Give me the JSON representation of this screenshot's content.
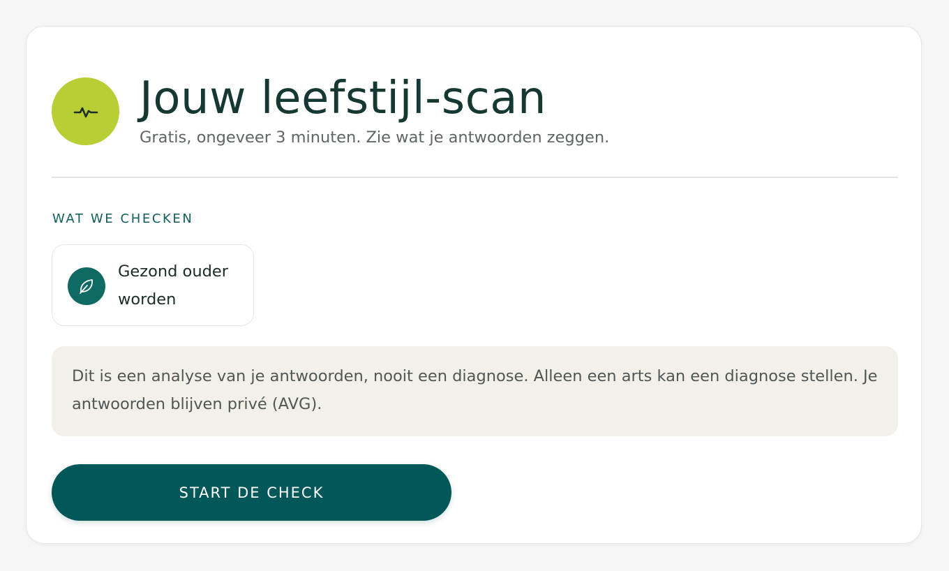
{
  "header": {
    "icon": "pulse-icon",
    "title": "Jouw leefstijl-scan",
    "subtitle": "Gratis, ongeveer 3 minuten. Zie wat je antwoorden zeggen."
  },
  "checks": {
    "section_label": "WAT WE CHECKEN",
    "items": [
      {
        "icon": "leaf-icon",
        "label": "Gezond ouder worden"
      }
    ]
  },
  "notice": {
    "text": "Dit is een analyse van je antwoorden, nooit een diagnose. Alleen een arts kan een diagnose stellen. Je antwoorden blijven privé (AVG)."
  },
  "actions": {
    "start_label": "START DE CHECK"
  },
  "colors": {
    "page_background": "#f5f6f5",
    "card_background": "#ffffff",
    "badge_lime": "#b9cd35",
    "title_text": "#163833",
    "section_label": "#0f5e5a",
    "leaf_badge": "#0e6a63",
    "notice_background": "#f3f0ea",
    "button_background": "#025759",
    "button_text": "#ffffff"
  }
}
